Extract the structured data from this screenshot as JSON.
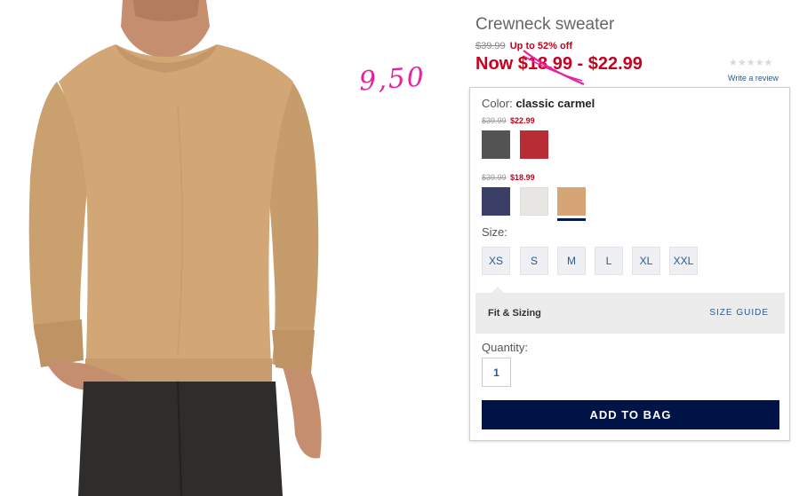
{
  "product": {
    "title": "Crewneck sweater",
    "original_price": "$39.99",
    "discount": "Up to 52% off",
    "now_price": "Now $18.99 - $22.99",
    "rating_stars": "★★★★★",
    "write_review": "Write a review"
  },
  "annotation": {
    "handwritten_price": "9,50"
  },
  "color": {
    "label": "Color:",
    "selected_name": "classic carmel",
    "groups": [
      {
        "old_price": "$39.99",
        "new_price": "$22.99",
        "swatches": [
          {
            "name": "charcoal",
            "hex": "#535353"
          },
          {
            "name": "red",
            "hex": "#b82c33"
          }
        ]
      },
      {
        "old_price": "$39.99",
        "new_price": "$18.99",
        "swatches": [
          {
            "name": "navy",
            "hex": "#3b3e66"
          },
          {
            "name": "light-grey",
            "hex": "#e7e6e3"
          },
          {
            "name": "classic-carmel",
            "hex": "#d6a576",
            "selected": true
          }
        ]
      }
    ]
  },
  "size": {
    "label": "Size:",
    "options": [
      "XS",
      "S",
      "M",
      "L",
      "XL",
      "XXL"
    ]
  },
  "fit": {
    "label": "Fit & Sizing",
    "size_guide": "SIZE GUIDE"
  },
  "quantity": {
    "label": "Quantity:",
    "value": "1"
  },
  "cta": {
    "add_to_bag": "ADD TO BAG"
  },
  "colors": {
    "sale_red": "#c8001f",
    "link_blue": "#2b5a8c",
    "cta_navy": "#001347",
    "annotation_pink": "#e8219f"
  }
}
